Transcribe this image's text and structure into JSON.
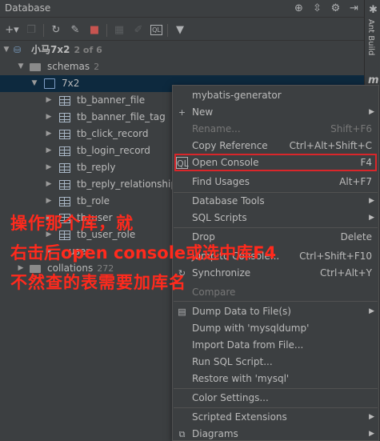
{
  "titlebar": {
    "title": "Database"
  },
  "gutter": {
    "ant_build": "Ant Build",
    "m_label": "m"
  },
  "tree": {
    "root": {
      "label": "小马7x2",
      "count": "2 of 6"
    },
    "schemas": {
      "label": "schemas",
      "count": "2"
    },
    "schema": {
      "label": "7x2"
    },
    "tables": [
      "tb_banner_file",
      "tb_banner_file_tag",
      "tb_click_record",
      "tb_login_record",
      "tb_reply",
      "tb_reply_relationship",
      "tb_role",
      "tb_user",
      "tb_user_role"
    ],
    "partial_item": "user",
    "collations": {
      "label": "collations",
      "count": "272"
    }
  },
  "menu": {
    "header": "mybatis-generator",
    "new": "New",
    "rename": {
      "label": "Rename...",
      "shortcut": "Shift+F6"
    },
    "copy_reference": {
      "label": "Copy Reference",
      "shortcut": "Ctrl+Alt+Shift+C"
    },
    "open_console": {
      "label": "Open Console",
      "shortcut": "F4"
    },
    "find_usages": {
      "label": "Find Usages",
      "shortcut": "Alt+F7"
    },
    "database_tools": "Database Tools",
    "sql_scripts": "SQL Scripts",
    "drop": {
      "label": "Drop",
      "shortcut": "Delete"
    },
    "jump_to_console": {
      "label": "Jump to Console...",
      "shortcut": "Ctrl+Shift+F10"
    },
    "synchronize": {
      "label": "Synchronize",
      "shortcut": "Ctrl+Alt+Y"
    },
    "compare": "Compare",
    "dump_to_file": "Dump Data to File(s)",
    "dump_mysqldump": "Dump with 'mysqldump'",
    "import_data": "Import Data from File...",
    "run_sql_script": "Run SQL Script...",
    "restore": "Restore with 'mysql'",
    "color_settings": "Color Settings...",
    "scripted_extensions": "Scripted Extensions",
    "diagrams": "Diagrams"
  },
  "annotation": {
    "line1": "操作那个库，就",
    "line2": "右击后open console或选中库F4",
    "line3": "不然查的表需要加库名"
  },
  "colors": {
    "annotation": "#ff2a1d",
    "highlight_box": "#d9262a",
    "selection": "#0d293e",
    "background": "#3c3f41"
  }
}
